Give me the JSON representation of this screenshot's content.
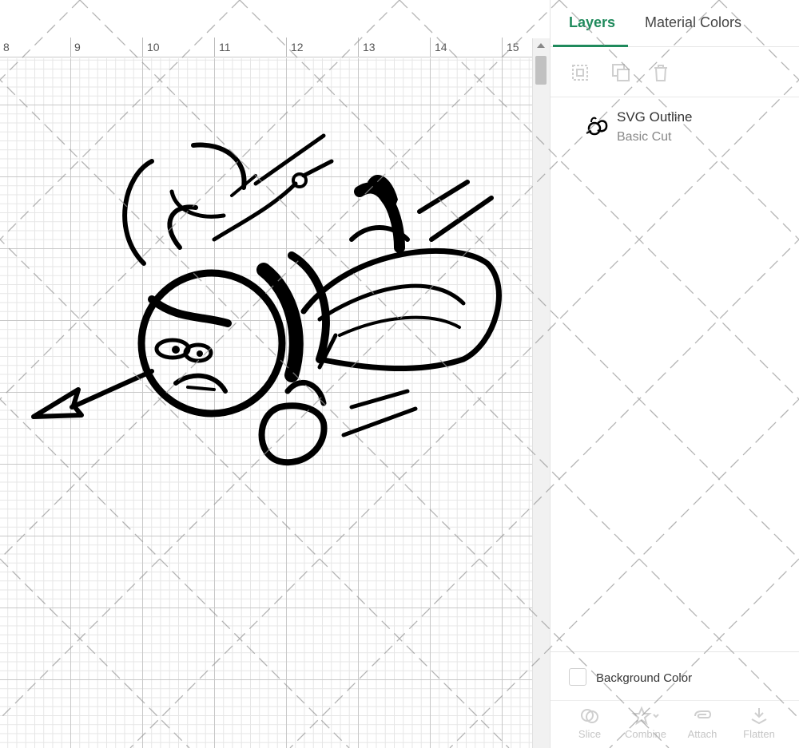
{
  "ruler": {
    "ticks": [
      "8",
      "9",
      "10",
      "11",
      "12",
      "13",
      "14",
      "15"
    ]
  },
  "panel": {
    "tabs": [
      {
        "label": "Layers",
        "active": true
      },
      {
        "label": "Material Colors",
        "active": false
      }
    ],
    "toolbar": {
      "icons": [
        "group-icon",
        "duplicate-icon",
        "delete-icon"
      ]
    },
    "layer": {
      "name": "SVG Outline",
      "type": "Basic Cut"
    },
    "background": {
      "label": "Background Color",
      "checked": false
    },
    "actions": [
      {
        "label": "Slice",
        "icon": "slice-icon"
      },
      {
        "label": "Combine",
        "icon": "combine-icon"
      },
      {
        "label": "Attach",
        "icon": "attach-icon"
      },
      {
        "label": "Flatten",
        "icon": "flatten-icon"
      }
    ]
  },
  "colors": {
    "accent": "#1f8a5c",
    "artwork": "#000000"
  }
}
